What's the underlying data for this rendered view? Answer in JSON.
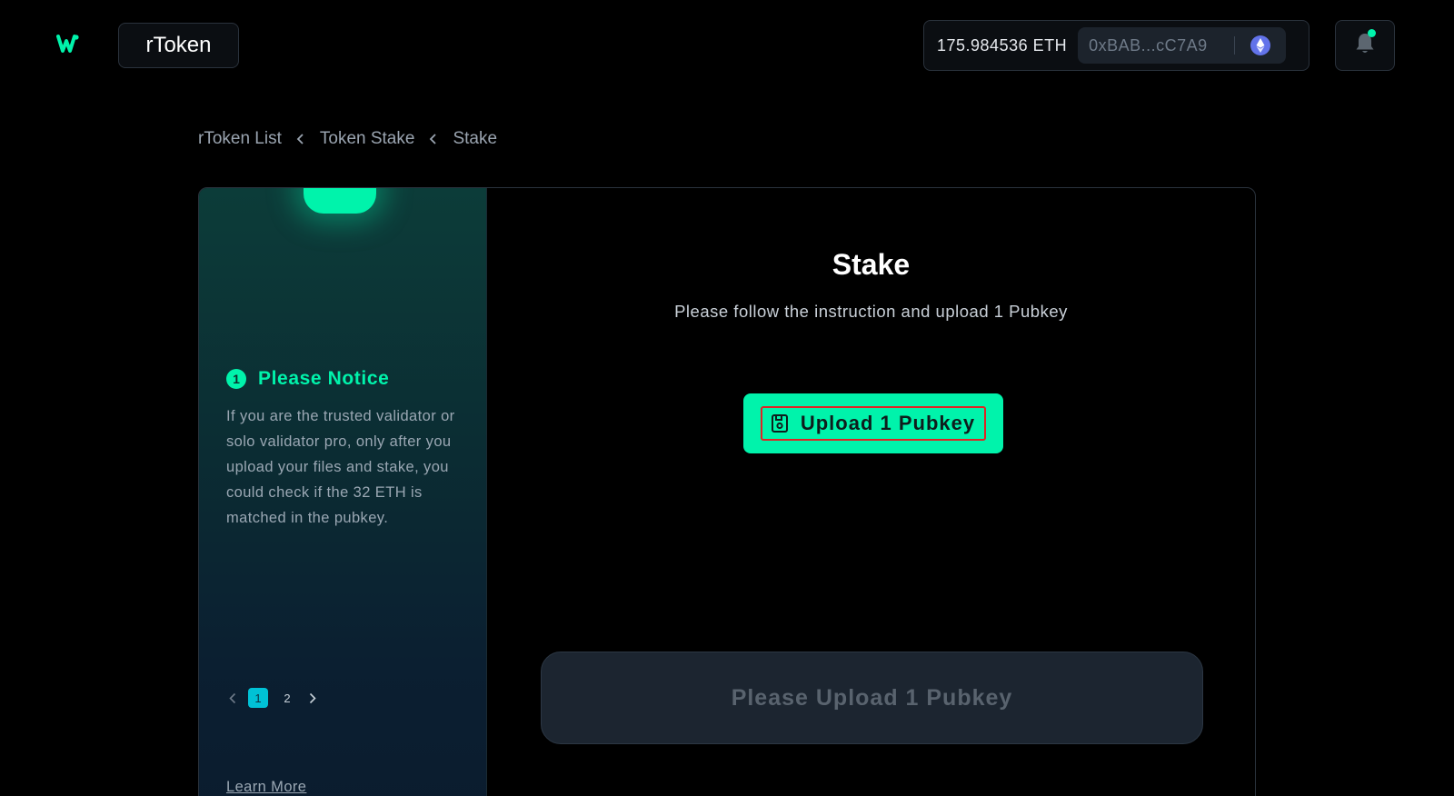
{
  "header": {
    "logo_icon": "wave-logo-icon",
    "app_name": "rToken",
    "balance": "175.984536 ETH",
    "address": "0xBAB...cC7A9",
    "network_icon": "ethereum-icon",
    "notification_icon": "bell-icon"
  },
  "breadcrumb": {
    "items": [
      "rToken List",
      "Token Stake",
      "Stake"
    ]
  },
  "sidebar": {
    "step_number": "1",
    "title": "Please Notice",
    "body": "If you are the trusted validator or solo validator pro, only after you upload your files and stake, you could check if the 32 ETH is matched in the pubkey.",
    "pages": [
      "1",
      "2"
    ],
    "active_page": "1",
    "learn_more": "Learn More"
  },
  "main": {
    "title": "Stake",
    "subtitle": "Please follow the instruction and upload 1 Pubkey",
    "upload_label": "Upload 1 Pubkey",
    "upload_icon": "file-upload-icon",
    "submit_label": "Please Upload 1 Pubkey"
  },
  "colors": {
    "accent": "#00f3ab",
    "background": "#000000",
    "page_active": "#00c2d6",
    "disabled_button": "#1c2530"
  }
}
